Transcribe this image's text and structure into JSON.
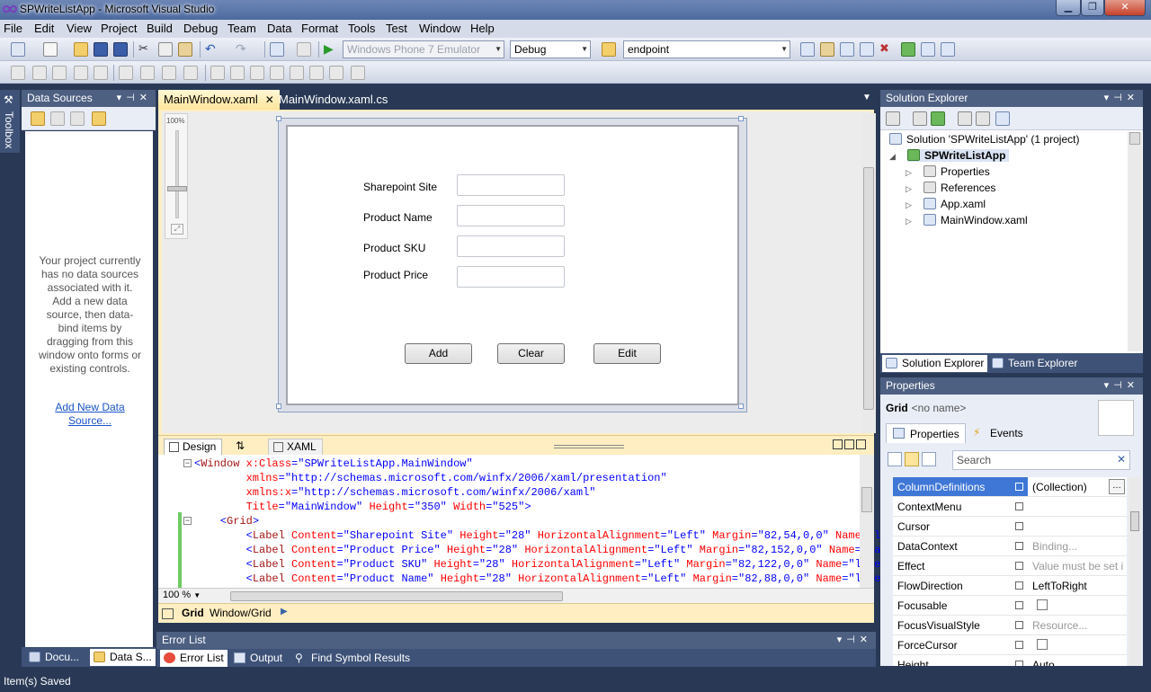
{
  "window": {
    "title": "SPWriteListApp - Microsoft Visual Studio",
    "controls": [
      "minimize",
      "maximize",
      "close"
    ]
  },
  "menu": [
    "File",
    "Edit",
    "View",
    "Project",
    "Build",
    "Debug",
    "Team",
    "Data",
    "Format",
    "Tools",
    "Test",
    "Window",
    "Help"
  ],
  "toolbar": {
    "target_device": "Windows Phone 7 Emulator",
    "configuration": "Debug",
    "find_text": "endpoint"
  },
  "toolbox_label": "Toolbox",
  "data_sources": {
    "title": "Data Sources",
    "message": "Your project currently has no data sources associated with it. Add a new data source, then data-bind items by dragging from this window onto forms or existing controls.",
    "link": "Add New Data Source..."
  },
  "left_bottom_tabs": [
    "Docu...",
    "Data S..."
  ],
  "doc_tabs": [
    "MainWindow.xaml",
    "MainWindow.xaml.cs"
  ],
  "designer": {
    "zoom_slider": "100%",
    "form_labels": [
      "Sharepoint Site",
      "Product Name",
      "Product SKU",
      "Product Price"
    ],
    "buttons": [
      "Add",
      "Clear",
      "Edit"
    ]
  },
  "split_tabs": {
    "design": "Design",
    "swap": "⇅",
    "xaml": "XAML"
  },
  "xaml_lines": [
    "<Window x:Class=\"SPWriteListApp.MainWindow\"",
    "        xmlns=\"http://schemas.microsoft.com/winfx/2006/xaml/presentation\"",
    "        xmlns:x=\"http://schemas.microsoft.com/winfx/2006/xaml\"",
    "        Title=\"MainWindow\" Height=\"350\" Width=\"525\">",
    "    <Grid>",
    "        <Label Content=\"Sharepoint Site\" Height=\"28\" HorizontalAlignment=\"Left\" Margin=\"82,54,0,0\" Name=\"l",
    "        <Label Content=\"Product Price\" Height=\"28\" HorizontalAlignment=\"Left\" Margin=\"82,152,0,0\" Name=\"la",
    "        <Label Content=\"Product SKU\" Height=\"28\" HorizontalAlignment=\"Left\" Margin=\"82,122,0,0\" Name=\"labe",
    "        <Label Content=\"Product Name\" Height=\"28\" HorizontalAlignment=\"Left\" Margin=\"82,88,0,0\" Name=\"labe"
  ],
  "editor_zoom": "100 %",
  "breadcrumb": {
    "element": "Grid",
    "path": "Window/Grid"
  },
  "error_list": {
    "title": "Error List",
    "tabs": [
      "Error List",
      "Output",
      "Find Symbol Results"
    ]
  },
  "solution_explorer": {
    "title": "Solution Explorer",
    "solution": "Solution 'SPWriteListApp' (1 project)",
    "project": "SPWriteListApp",
    "items": [
      "Properties",
      "References",
      "App.xaml",
      "MainWindow.xaml"
    ],
    "tabs": [
      "Solution Explorer",
      "Team Explorer"
    ]
  },
  "properties": {
    "title": "Properties",
    "element_type": "Grid",
    "element_name": "<no name>",
    "tabs": [
      "Properties",
      "Events"
    ],
    "search_placeholder": "Search",
    "rows": [
      {
        "name": "ColumnDefinitions",
        "value": "(Collection)"
      },
      {
        "name": "ContextMenu",
        "value": ""
      },
      {
        "name": "Cursor",
        "value": ""
      },
      {
        "name": "DataContext",
        "value": "Binding..."
      },
      {
        "name": "Effect",
        "value": "Value must be set i"
      },
      {
        "name": "FlowDirection",
        "value": "LeftToRight"
      },
      {
        "name": "Focusable",
        "value": ""
      },
      {
        "name": "FocusVisualStyle",
        "value": "Resource..."
      },
      {
        "name": "ForceCursor",
        "value": ""
      },
      {
        "name": "Height",
        "value": "Auto"
      }
    ]
  },
  "status": "Item(s) Saved",
  "colors": {
    "chrome_dark": "#293955",
    "panel_title": "#4d6082",
    "active_tab": "#ffe59b",
    "selection": "#3f77d6"
  }
}
